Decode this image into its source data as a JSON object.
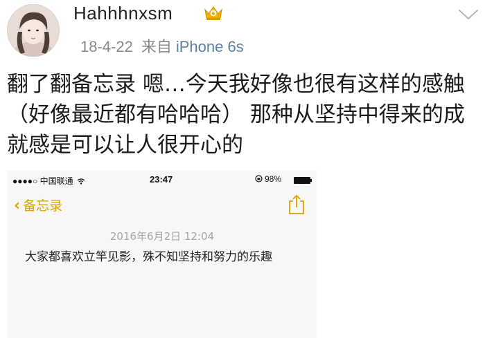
{
  "post": {
    "username": "Hahhhnxsm",
    "date": "18-4-22",
    "source_prefix": "来自",
    "source": "iPhone 6s",
    "text": "翻了翻备忘录  嗯…今天我好像也很有这样的感触（好像最近都有哈哈哈）  那种从坚持中得来的成就感是可以让人很开心的"
  },
  "icons": {
    "avatar": "avatar",
    "badge": "crown-badge-icon",
    "menu": "chevron-down-icon"
  },
  "screenshot": {
    "statusbar": {
      "carrier": "●●●●○ 中国联通",
      "wifi": "wifi-icon",
      "time": "23:47",
      "battery_text": "98%",
      "battery_level": 0.98
    },
    "navbar": {
      "back_label": "备忘录",
      "back_icon": "‹"
    },
    "note": {
      "date": "2016年6月2日  12:04",
      "body": "大家都喜欢立竿见影，殊不知坚持和努力的乐趣"
    }
  },
  "colors": {
    "accent": "#d9a300",
    "link": "#5b7fa8",
    "muted": "#8a8a8a",
    "badge": "#f5b400"
  }
}
